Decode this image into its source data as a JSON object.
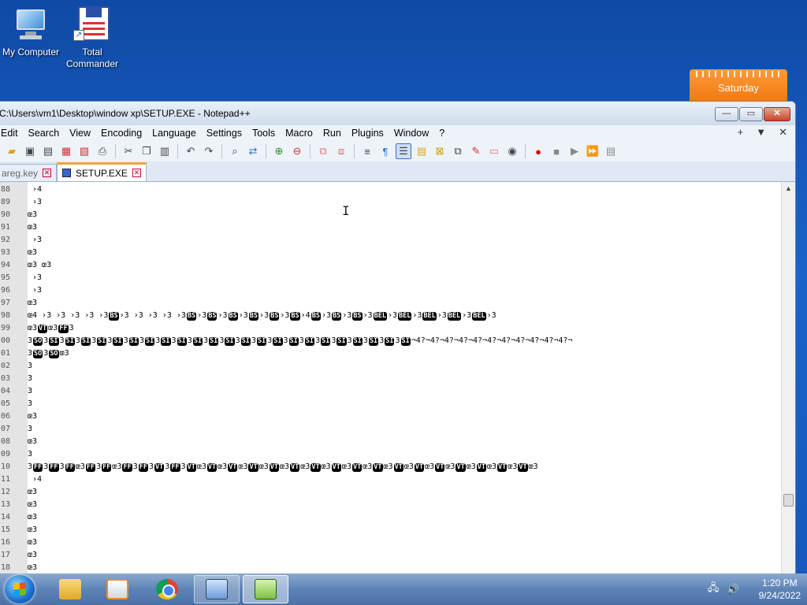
{
  "desktop": {
    "icons": [
      {
        "label": "My Computer"
      },
      {
        "label_line1": "Total",
        "label_line2": "Commander"
      }
    ],
    "calendar_day": "Saturday"
  },
  "window": {
    "title": "C:\\Users\\vm1\\Desktop\\window xp\\SETUP.EXE - Notepad++",
    "controls": {
      "minimize": "—",
      "maximize": "▭",
      "close": "✕"
    },
    "menu": [
      "Edit",
      "Search",
      "View",
      "Encoding",
      "Language",
      "Settings",
      "Tools",
      "Macro",
      "Run",
      "Plugins",
      "Window",
      "?"
    ],
    "menu_right": [
      "+",
      "▼",
      "✕"
    ],
    "tabs": [
      {
        "label": "areg.key",
        "active": false
      },
      {
        "label": "SETUP.EXE",
        "active": true
      }
    ]
  },
  "editor": {
    "lines": [
      {
        "num": "88",
        "text": " ›4"
      },
      {
        "num": "89",
        "text": " ›3"
      },
      {
        "num": "90",
        "text": "œ3"
      },
      {
        "num": "91",
        "text": "œ3"
      },
      {
        "num": "92",
        "text": " ›3"
      },
      {
        "num": "93",
        "text": "œ3"
      },
      {
        "num": "94",
        "text": "œ3   œ3"
      },
      {
        "num": "95",
        "text": " ›3"
      },
      {
        "num": "96",
        "text": " ›3"
      },
      {
        "num": "97",
        "text": "œ3"
      },
      {
        "num": "98",
        "text": "œ4   ›3    ›3    ›3    ›3    ›3[BS]›3    ›3    ›3    ›3    ›3[BS]›3[BS]›3[BS]›3[BS]›3[BS]›3[BS]›4[BS]›3[BS]›3[BS]›3[BEL]›3[BEL]›3[BEL]›3[BEL]›3[BEL]›3"
      },
      {
        "num": "99",
        "text": "œ3[VT]œ3[FF]3"
      },
      {
        "num": "00",
        "text": "3[SO]3[SI]3[SI]3[SI]3[SI]3[SI]3[SI]3[SI]3[SI]3[SI]3[SI]3[SI]3[SI]3[SI]3[SI]3[SI]3[SI]3[SI]3[SI]3[SI]3[SI]3[SI]3[SI]3[SI]¬4?¬4?¬4?¬4?¬4?¬4?¬4?¬4?¬4?¬4?¬4?¬"
      },
      {
        "num": "01",
        "text": "3[SO]3[SO]œ3"
      },
      {
        "num": "02",
        "text": "3"
      },
      {
        "num": "03",
        "text": "3"
      },
      {
        "num": "04",
        "text": "3"
      },
      {
        "num": "05",
        "text": "3"
      },
      {
        "num": "06",
        "text": "œ3"
      },
      {
        "num": "07",
        "text": "3"
      },
      {
        "num": "08",
        "text": "œ3"
      },
      {
        "num": "09",
        "text": "3"
      },
      {
        "num": "10",
        "text": "3[FF]3[FF]3[FF]œ3[FF]3[FF]œ3[FF]3[FF]3[VT]3[FF]3[VT]œ3[VT]œ3[VT]œ3[VT]œ3[VT]œ3[VT]œ3[VT]œ3[VT]œ3[VT]œ3[VT]œ3[VT]œ3[VT]œ3[VT]œ3[VT]œ3[VT]œ3[VT]œ3[VT]œ3"
      },
      {
        "num": "11",
        "text": " ›4"
      },
      {
        "num": "12",
        "text": "œ3"
      },
      {
        "num": "13",
        "text": "œ3"
      },
      {
        "num": "14",
        "text": "œ3"
      },
      {
        "num": "15",
        "text": "œ3"
      },
      {
        "num": "16",
        "text": "œ3"
      },
      {
        "num": "17",
        "text": "œ3"
      },
      {
        "num": "18",
        "text": "œ3"
      }
    ]
  },
  "taskbar": {
    "clock_time": "1:20 PM",
    "clock_date": "9/24/2022"
  },
  "colors": {
    "accent": "#f7a436",
    "token_bg": "#000000"
  }
}
